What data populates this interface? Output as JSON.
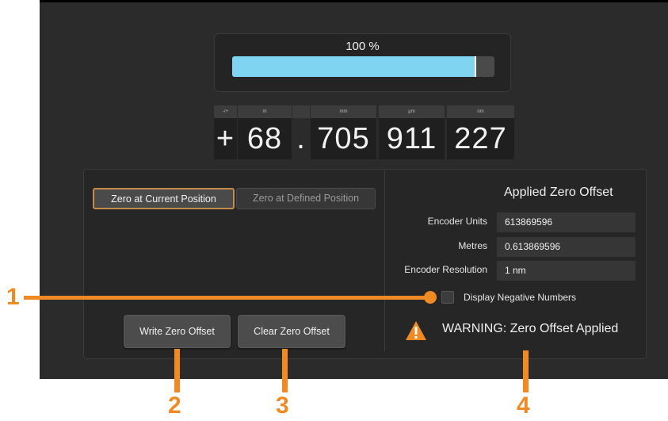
{
  "progress": {
    "label": "100 %",
    "fraction": 0.93
  },
  "readout": {
    "headers": {
      "sign": "-/+",
      "m": "m",
      "mm": "mm",
      "um": "µm",
      "nm": "nm"
    },
    "sign": "+",
    "metres": "68",
    "separator": ".",
    "millimetres": "705",
    "micrometres": "911",
    "nanometres": "227"
  },
  "tabs": {
    "current": "Zero at Current Position",
    "defined": "Zero at Defined Position"
  },
  "buttons": {
    "write": "Write Zero Offset",
    "clear": "Clear Zero Offset"
  },
  "offset": {
    "title": "Applied Zero Offset",
    "encoder_units_label": "Encoder Units",
    "encoder_units_value": "613869596",
    "metres_label": "Metres",
    "metres_value": "0.613869596",
    "resolution_label": "Encoder Resolution",
    "resolution_value": "1 nm"
  },
  "checkbox": {
    "label": "Display Negative Numbers",
    "checked": false
  },
  "warning": {
    "text": "WARNING: Zero Offset Applied",
    "icon": "warning-triangle-icon"
  },
  "callouts": {
    "c1": "1",
    "c2": "2",
    "c3": "3",
    "c4": "4"
  },
  "colors": {
    "accent": "#f08a24",
    "progress_fill": "#7fd4f2",
    "tab_focus": "#c58b4a"
  }
}
